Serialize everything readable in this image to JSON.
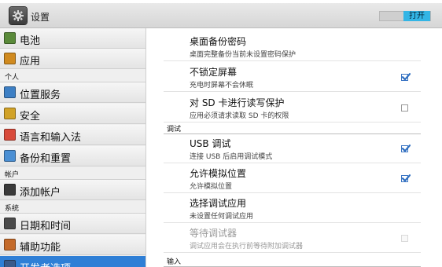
{
  "action_bar": {
    "title": "设置",
    "master_switch_label": "打开",
    "master_switch_state": "on",
    "accent": "#33b5e5"
  },
  "sidebar": {
    "items": [
      {
        "label": "电池",
        "icon": "battery-icon",
        "color": "#5a8a3a"
      },
      {
        "label": "应用",
        "icon": "apps-icon",
        "color": "#d08a1f"
      },
      {
        "header": "个人"
      },
      {
        "label": "位置服务",
        "icon": "location-icon",
        "color": "#3d7fc4"
      },
      {
        "label": "安全",
        "icon": "lock-icon",
        "color": "#d1a227"
      },
      {
        "label": "语言和输入法",
        "icon": "language-icon",
        "color": "#d84a3a"
      },
      {
        "label": "备份和重置",
        "icon": "backup-icon",
        "color": "#4a8fd4"
      },
      {
        "header": "帐户"
      },
      {
        "label": "添加帐户",
        "icon": "add-account-icon",
        "color": "#3a3a3a"
      },
      {
        "header": "系统"
      },
      {
        "label": "日期和时间",
        "icon": "clock-icon",
        "color": "#4a4a4a"
      },
      {
        "label": "辅助功能",
        "icon": "accessibility-icon",
        "color": "#c46a2a"
      },
      {
        "label": "开发者选项",
        "icon": "developer-options-icon",
        "color": "#3a5a8a",
        "active": true
      }
    ]
  },
  "content": {
    "entries": [
      {
        "title": "桌面备份密码",
        "summary": "桌面完整备份当前未设置密码保护"
      },
      {
        "title": "不锁定屏幕",
        "summary": "充电时屏幕不会休眠",
        "checked": true
      },
      {
        "title": "对 SD 卡进行读写保护",
        "summary": "应用必须请求读取 SD 卡的权限",
        "checked": false
      },
      {
        "section": "调试"
      },
      {
        "title": "USB 调试",
        "summary": "连接 USB 后启用调试模式",
        "checked": true
      },
      {
        "title": "允许模拟位置",
        "summary": "允许模拟位置",
        "checked": true
      },
      {
        "title": "选择调试应用",
        "summary": "未设置任何调试应用"
      },
      {
        "title": "等待调试器",
        "summary": "调试应用会在执行前等待附加调试器",
        "checked": false,
        "disabled": true
      },
      {
        "section": "输入"
      }
    ]
  },
  "colors": {
    "selected_item": "#2f7fd6",
    "checkbox_check": "#2f6fc0"
  }
}
